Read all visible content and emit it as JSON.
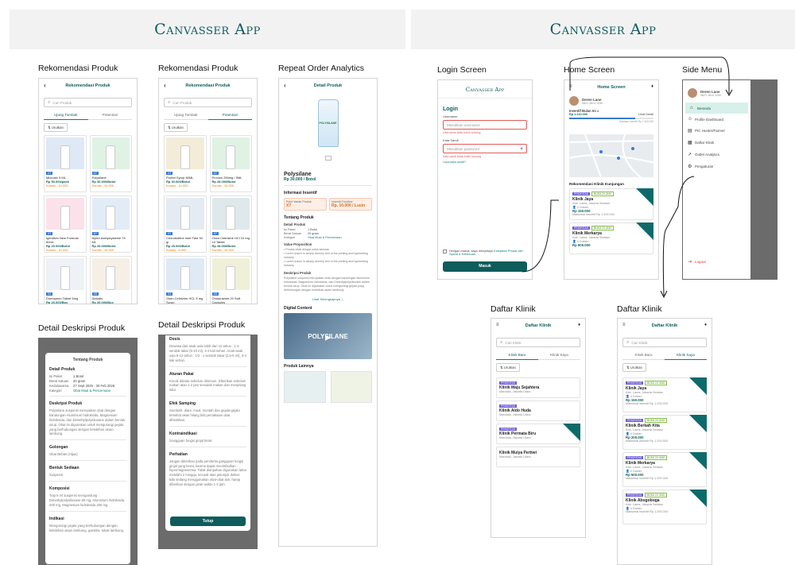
{
  "brand": "Canvasser App",
  "brand_small": "Canvasser App",
  "sections": {
    "rek1": "Rekomendasi Produk",
    "rek2": "Rekomendasi Produk",
    "repeat": "Repeat Order Analytics",
    "detail1": "Detail Deskripsi Produk",
    "detail2": "Detail Deskripsi Produk",
    "login": "Login Screen",
    "home": "Home Screen",
    "side": "Side Menu",
    "klinik1": "Daftar Klinik",
    "klinik2": "Daftar Klinik"
  },
  "rekomendasi": {
    "header": "Rekomendasi Produk",
    "search_placeholder": "Cari Produk",
    "tab_a": "Ujung Tombak",
    "tab_b": "Potensial",
    "urutkan": "Urutkan",
    "products_a": [
      {
        "name": "Microlax 5 ML",
        "price": "Rp 50.000/pack",
        "kom": "Komisi : 10.000",
        "tag": "X7",
        "color": "#dfe9f5"
      },
      {
        "name": "Polysilane",
        "price": "Rp 30.000/Botol",
        "kom": "Komisi : 10.000",
        "tag": "X7",
        "color": "#dff2e3"
      },
      {
        "name": "Igenitivin New Formula 60mL",
        "price": "Rp 20.000/Botol",
        "kom": "Komisi : 10.000",
        "tag": "X7",
        "color": "#fbe2ea"
      },
      {
        "name": "Nytex Acetylcysteine 75 ML",
        "price": "Rp 20.000/Botol",
        "kom": "Komisi : 10.000",
        "tag": "X7",
        "color": "#e2ecf7"
      },
      {
        "name": "Domoperin Tablet 5mg",
        "price": "Rp 20.000/Box",
        "kom": "",
        "tag": "X3",
        "color": "#eef1f5"
      },
      {
        "name": "Diatabs",
        "price": "Rp 20.000/Box",
        "kom": "",
        "tag": "X3",
        "color": "#f5efe6"
      }
    ],
    "products_b": [
      {
        "name": "Profed Syrup 60ML",
        "price": "Rp 30.000/Botol",
        "kom": "Komisi : 10.000",
        "tag": "X7",
        "color": "#f3ecd8"
      },
      {
        "name": "Proxion 250mg / 5ML",
        "price": "Rp 28.000/Botol",
        "kom": "Komisi : 10.000",
        "tag": "X7",
        "color": "#dff2e3"
      },
      {
        "name": "Chondroitine Inlet Fast 30 gr",
        "price": "Rp 25.000/Botol",
        "kom": "Komisi : 8.000",
        "tag": "X7",
        "color": "#e5ebf3"
      },
      {
        "name": "Osen Cetirizine HCl 10 mg 10 Tablet",
        "price": "Rp 28.000/Botol",
        "kom": "Komisi : 10.000",
        "tag": "X7",
        "color": "#dfe9ec"
      },
      {
        "name": "Osen Cetirizine HCL 5 mg Syrup",
        "price": "Rp 20.000/Botol",
        "kom": "",
        "tag": "X3",
        "color": "#dfeaf5"
      },
      {
        "name": "Omeprazole 20 Soft Capsules",
        "price": "Rp 20.000/Box",
        "kom": "",
        "tag": "X3",
        "color": "#f0f0d8"
      }
    ]
  },
  "detail_produk": {
    "header": "Detail Produk",
    "name": "Polysilane",
    "price": "Rp 30.000 / Botol",
    "info_title": "Informasi Insentif",
    "poin_label": "Point Varian Produk",
    "poin_value": "X7",
    "insentif_label": "Insentif Frontline",
    "insentif_value": "Rp. 10.000 / Lusin",
    "about_title": "Tentang Produk",
    "detail_title": "Detail Produk",
    "isi_k": "Isi Paket",
    "isi_v": "1 Botol",
    "berat_k": "Berat Satuan",
    "berat_v": "20 gram",
    "kat_k": "Kategori",
    "kat_v": "Obat Mual & Pencernaan",
    "vp_title": "Value Proposition",
    "vp_1": "Produk lebih diingat untuk sebulan",
    "vp_2": "Lorem Ipsum is simply dummy text of the printing and typesetting industry.",
    "vp_3": "Lorem Ipsum is simply dummy text of the printing and typesetting industry.",
    "desk_title": "Deskripsi Produk",
    "desk_text": "Polysilane suspensi merupakan obat dengan kandungan Aluminium hidroksida, Magnesium hidroksida, dan Dimethylpolysiloxane dalam bentuk sirup. Obat ini digunakan untuk mengurangi gejala yang berhubungan dengan kelebihan asam lambung.",
    "lihat": "Lihat Selengkapnya",
    "digital": "Digital Content",
    "video_brand": "POLYSILANE",
    "lainnya": "Produk Lainnya"
  },
  "deskripsi": {
    "sheet_title": "Tentang Produk",
    "detail_title": "Detail Produk",
    "isi_k": "Isi Paket",
    "isi_v": "1 Botol",
    "berat_k": "Berat Satuan",
    "berat_v": "20 gram",
    "kadal_k": "Kedaluwarsa",
    "kadal_v": "27 Sept 2025 - 30 Feb 2026",
    "kat_k": "Kategori",
    "kat_v": "Obat Mual & Pencernaan",
    "desk_title": "Deskripsi Produk",
    "desk_text": "Polysilane suspensi merupakan obat dengan kandungan Aluminium hidroksida, Magnesium hidroksida, dan Dimethylpolysiloxane dalam bentuk sirup. Obat ini digunakan untuk mengurangi gejala yang berhubungan dengan kelebihan asam lambung.",
    "gol_title": "Golongan",
    "gol_v": "Obat Bebas (Hijau)",
    "bentuk_title": "Bentuk Sediaan",
    "bentuk_v": "Suspensi",
    "komp_title": "Komposisi",
    "komp_v": "Tiap 5 ml suspensi mengandung : Dimethylpolysiloxane 80 mg, Aluminium hidroksida 200 mg, Magnesium hidroksida 200 mg",
    "ind_title": "Indikasi",
    "ind_v": "Mengurangi gejala yang berhubungan dengan kelebihan asam lambung, gastritis, tukak lambung.",
    "dosis_title": "Dosis",
    "dosis_v": "Dewasa dan anak usia lebih dari 12 tahun : 1-4 sendok takar (5-10 ml), 3-4 kali sehari. Anak-anak usia 6-12 tahun : 1/2 - 1 sendok takar (2,5-5 ml), 3-4 kali sehari.",
    "aturan_title": "Aturan Pakai",
    "aturan_v": "Kocok dahulu sebelum diminum. Diberikan sebelum makan atau 1-2 jam sesudah makan dan menjelang tidur.",
    "efek_title": "Efek Samping",
    "efek_v": "Sembelit, diare, mual, muntah dan gejala-gejala tersebut akan hilang bila pemakaian obat dihentikan.",
    "kontra_title": "Kontraindikasi",
    "kontra_v": "Gangguan fungsi ginjal berat",
    "perhatian_title": "Perhatian",
    "perhatian_v": "Jangan diberikan pada penderita gangguan fungsi ginjal yang berat, karena dapat menimbulkan hipermagnesemia. Tidak dianjurkan digunakan lama melebihi 2 minggu, kecuali atas petunjuk dokter. Bila sedang menggunakan obat-obat lain, harap diberikan dengan jarak waktu 1-2 jam.",
    "tutup": "Tutup"
  },
  "login": {
    "title": "Login",
    "user_label": "Username",
    "user_ph": "Masukkan username",
    "user_err": "Username tidak boleh kosong",
    "pass_label": "Kata Sandi",
    "pass_ph": "Masukkan password",
    "pass_err": "Kata sandi tidak boleh kosong",
    "forgot": "Lupa kata sandi?",
    "terms_pre": "Dengan masuk, saya menyetujui",
    "terms_link": "Kebijakan Privasi dan Syarat & Ketentuan",
    "masuk": "Masuk"
  },
  "home": {
    "header": "Home Screen",
    "user_name": "Deren Lane",
    "user_phone": "0821 2814 1240",
    "insentif_label": "Insentif Bulan Ini",
    "insentif_value": "Rp 1.210.000",
    "lihat": "Lihat Detail",
    "target": "Batasan insentif Rp 1.500.000",
    "progress": 0.78,
    "rek_title": "Rekomendasi Klinik Kunjungan",
    "klinik": [
      {
        "name": "Klinik Jaya",
        "addr": "Kab. Lama, Jakarta Selatan",
        "dok": "4 Dokter",
        "val": "Rp 150.000",
        "foot": "Maksimal insentif Rp 1.200.000"
      },
      {
        "name": "Klinik Merkarya",
        "addr": "Kab. Lama, Jakarta Selatan",
        "dok": "4 Dokter",
        "val": "Rp 500.000",
        "foot": ""
      }
    ]
  },
  "side": {
    "user_name": "Deren Lane",
    "user_phone": "0821 2814 1240",
    "items": [
      "Beranda",
      "Profile Dashboard",
      "PIC Hunter/Farmer",
      "Daftar Klinik",
      "Outlet Analytics",
      "Pengaturan"
    ],
    "logout": "Logout"
  },
  "daftar": {
    "header": "Daftar Klinik",
    "search_ph": "Cari Klinik",
    "tab_a": "Klinik Baru",
    "tab_b": "Klinik Saya",
    "urutkan": "Urutkan",
    "badge_a": "PRIORITAS",
    "badge_b": "BUKA 24 JAM",
    "baru": [
      {
        "name": "Klinik Maju Sejahtera",
        "addr": "Mandala, Jakarta Utara"
      },
      {
        "name": "Klinik Aldo Huda",
        "addr": "Mandala, Jakarta Utara"
      },
      {
        "name": "Klinik Permata Biru",
        "addr": "Mandala, Jakarta Utara"
      },
      {
        "name": "Klinik Mulya Pertiwi",
        "addr": "Mandala, Jakarta Utara"
      }
    ],
    "saya": [
      {
        "name": "Klinik Jaya",
        "addr": "Kab. Lama, Jakarta Selatan",
        "val": "Rp 150.000"
      },
      {
        "name": "Klinik Berkah Kita",
        "addr": "Kab. Lama, Jakarta Selatan",
        "val": "Rp 200.000"
      },
      {
        "name": "Klinik Merkarya",
        "addr": "Kab. Lama, Jakarta Selatan",
        "val": "Rp 500.000"
      },
      {
        "name": "Klinik Abogoboga",
        "addr": "Kab. Lama, Jakarta Selatan",
        "val": ""
      }
    ],
    "dokter": "4 Dokter",
    "foot": "Maksimal insentif Rp 1.200.000"
  }
}
